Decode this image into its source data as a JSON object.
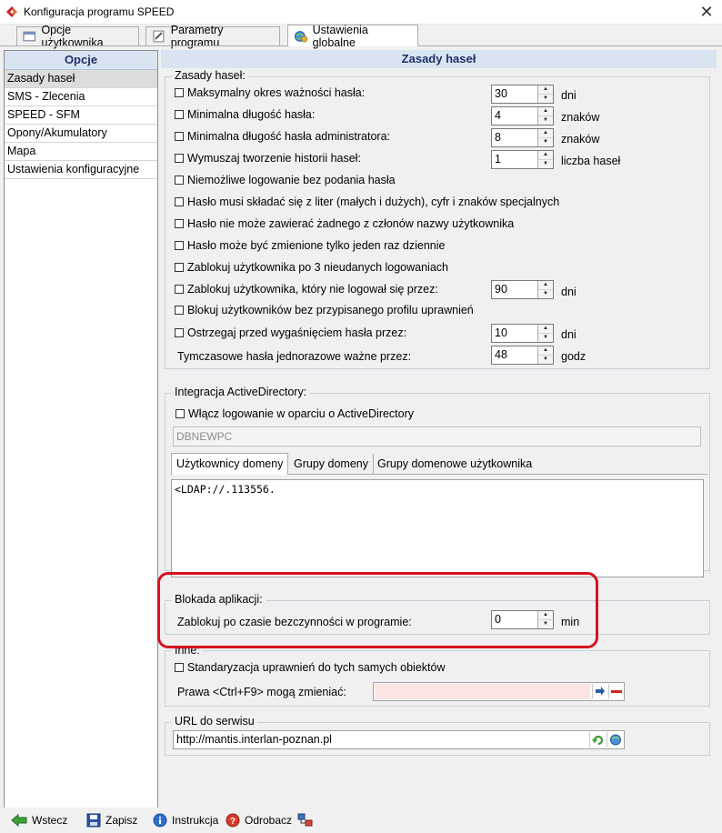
{
  "window": {
    "title": "Konfiguracja programu SPEED",
    "close": "✕"
  },
  "tabs": [
    {
      "label": "Opcje użytkownika"
    },
    {
      "label": "Parametry programu"
    },
    {
      "label": "Ustawienia globalne"
    }
  ],
  "sidebar": {
    "header": "Opcje",
    "items": [
      {
        "label": "Zasady haseł"
      },
      {
        "label": "SMS - Zlecenia"
      },
      {
        "label": "SPEED - SFM"
      },
      {
        "label": "Opony/Akumulatory"
      },
      {
        "label": "Mapa"
      },
      {
        "label": "Ustawienia konfiguracyjne"
      }
    ]
  },
  "main": {
    "header": "Zasady haseł"
  },
  "password_rules": {
    "legend": "Zasady haseł:",
    "rows": [
      {
        "label": "Maksymalny okres ważności hasła:",
        "value": "30",
        "unit": "dni"
      },
      {
        "label": "Minimalna długość hasła:",
        "value": "4",
        "unit": "znaków"
      },
      {
        "label": "Minimalna długość hasła administratora:",
        "value": "8",
        "unit": "znaków"
      },
      {
        "label": "Wymuszaj tworzenie historii haseł:",
        "value": "1",
        "unit": "liczba haseł"
      },
      {
        "label": "Niemożliwe logowanie bez podania hasła"
      },
      {
        "label": "Hasło musi składać się z liter (małych i dużych), cyfr i znaków specjalnych"
      },
      {
        "label": "Hasło nie może zawierać żadnego z członów nazwy użytkownika"
      },
      {
        "label": "Hasło może być zmienione tylko jeden raz dziennie"
      },
      {
        "label": "Zablokuj użytkownika po 3 nieudanych logowaniach"
      },
      {
        "label": "Zablokuj użytkownika, który nie logował się przez:",
        "value": "90",
        "unit": "dni"
      },
      {
        "label": "Blokuj użytkowników bez przypisanego profilu uprawnień"
      },
      {
        "label": "Ostrzegaj przed wygaśnięciem hasła przez:",
        "value": "10",
        "unit": "dni"
      },
      {
        "label": "Tymczasowe hasła jednorazowe ważne przez:",
        "value": "48",
        "unit": "godz"
      }
    ]
  },
  "active_directory": {
    "legend": "Integracja ActiveDirectory:",
    "enable_label": "Włącz logowanie w oparciu o ActiveDirectory",
    "domain_value": "DBNEWPC",
    "tabs": [
      {
        "label": "Użytkownicy domeny"
      },
      {
        "label": "Grupy domeny"
      },
      {
        "label": "Grupy domenowe użytkownika"
      }
    ],
    "content": "<LDAP://.113556."
  },
  "app_lock": {
    "legend": "Blokada aplikacji:",
    "label": "Zablokuj po czasie bezczynności w programie:",
    "value": "0",
    "unit": "min"
  },
  "other": {
    "legend": "Inne:",
    "standardize_label": "Standaryzacja uprawnień do tych samych obiektów",
    "rights_label": "Prawa <Ctrl+F9> mogą zmieniać:",
    "rights_value": ""
  },
  "service_url": {
    "legend": "URL do serwisu",
    "value": "http://mantis.interlan-poznan.pl"
  },
  "toolbar": {
    "back": "Wstecz",
    "save": "Zapisz",
    "help": "Instrukcja",
    "reload": "Odrobacz"
  },
  "colors": {
    "header_bg": "#d9e4f1",
    "header_text": "#1f2f6b",
    "highlight": "#d6131e"
  }
}
